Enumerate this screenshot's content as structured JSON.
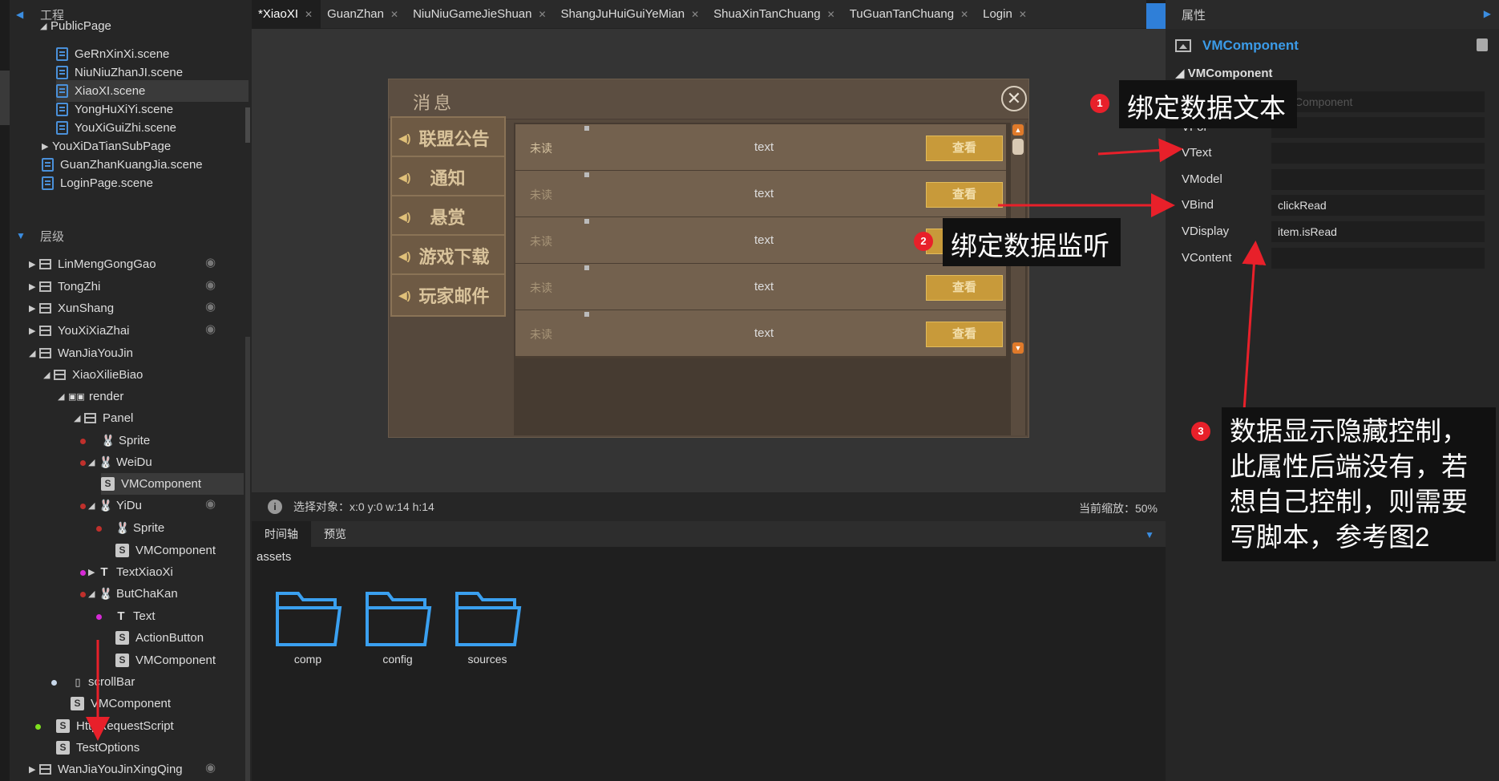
{
  "left": {
    "project_label": "工程",
    "hierarchy_label": "层级",
    "project_tree": [
      {
        "label": "PublicPage"
      },
      {
        "label": "GeRnXinXi.scene"
      },
      {
        "label": "NiuNiuZhanJI.scene"
      },
      {
        "label": "XiaoXI.scene"
      },
      {
        "label": "YongHuXiYi.scene"
      },
      {
        "label": "YouXiGuiZhi.scene"
      },
      {
        "label": "YouXiDaTianSubPage"
      },
      {
        "label": "GuanZhanKuangJia.scene"
      },
      {
        "label": "LoginPage.scene"
      }
    ],
    "hierarchy": [
      {
        "label": "LinMengGongGao"
      },
      {
        "label": "TongZhi"
      },
      {
        "label": "XunShang"
      },
      {
        "label": "YouXiXiaZhai"
      },
      {
        "label": "WanJiaYouJin"
      },
      {
        "label": "XiaoXilieBiao"
      },
      {
        "label": "render"
      },
      {
        "label": "Panel"
      },
      {
        "label": "Sprite"
      },
      {
        "label": "WeiDu"
      },
      {
        "label": "VMComponent"
      },
      {
        "label": "YiDu"
      },
      {
        "label": "Sprite"
      },
      {
        "label": "VMComponent"
      },
      {
        "label": "TextXiaoXi"
      },
      {
        "label": "ButChaKan"
      },
      {
        "label": "Text"
      },
      {
        "label": "ActionButton"
      },
      {
        "label": "VMComponent"
      },
      {
        "label": "scrollBar"
      },
      {
        "label": "VMComponent"
      },
      {
        "label": "HttpRequestScript"
      },
      {
        "label": "TestOptions"
      },
      {
        "label": "WanJiaYouJinXingQing"
      }
    ]
  },
  "tabs": [
    {
      "label": "*XiaoXI"
    },
    {
      "label": "GuanZhan"
    },
    {
      "label": "NiuNiuGameJieShuan"
    },
    {
      "label": "ShangJuHuiGuiYeMian"
    },
    {
      "label": "ShuaXinTanChuang"
    },
    {
      "label": "TuGuanTanChuang"
    },
    {
      "label": "Login"
    }
  ],
  "scene": {
    "dialog_title": "消息",
    "close_glyph": "✕",
    "nav": [
      {
        "label": "联盟公告"
      },
      {
        "label": "通知"
      },
      {
        "label": "悬赏"
      },
      {
        "label": "游戏下载"
      },
      {
        "label": "玩家邮件"
      }
    ],
    "items": [
      {
        "unread": "未读",
        "text": "text",
        "btn": "查看"
      },
      {
        "unread": "未读",
        "text": "text",
        "btn": "查看"
      },
      {
        "unread": "未读",
        "text": "text",
        "btn": "查看"
      },
      {
        "unread": "未读",
        "text": "text",
        "btn": "查看"
      },
      {
        "unread": "未读",
        "text": "text",
        "btn": "查看"
      }
    ]
  },
  "status": {
    "select_label": "选择对象：x:0 y:0  w:14 h:14",
    "zoom_label": "当前缩放：50%"
  },
  "bottom": {
    "tabs": [
      {
        "label": "时间轴"
      },
      {
        "label": "预览"
      }
    ],
    "assets_label": "assets",
    "folders": [
      {
        "label": "comp"
      },
      {
        "label": "config"
      },
      {
        "label": "sources"
      }
    ]
  },
  "right": {
    "panel_title": "属性",
    "component_name": "VMComponent",
    "section": "VMComponent",
    "props": [
      {
        "key": "",
        "value": "VMComponent"
      },
      {
        "key": "VFor",
        "value": ""
      },
      {
        "key": "VText",
        "value": ""
      },
      {
        "key": "VModel",
        "value": ""
      },
      {
        "key": "VBind",
        "value": "clickRead"
      },
      {
        "key": "VDisplay",
        "value": "item.isRead"
      },
      {
        "key": "VContent",
        "value": ""
      }
    ]
  },
  "annotations": [
    {
      "num": "1",
      "text": "绑定数据文本"
    },
    {
      "num": "2",
      "text": "绑定数据监听"
    },
    {
      "num": "3",
      "text": "数据显示隐藏控制，此属性后端没有，若想自己控制，则需要写脚本，参考图2"
    }
  ],
  "colors": {
    "accent": "#3b9be8",
    "annotation_red": "#e8202a",
    "button_gold": "#c89a3a"
  }
}
